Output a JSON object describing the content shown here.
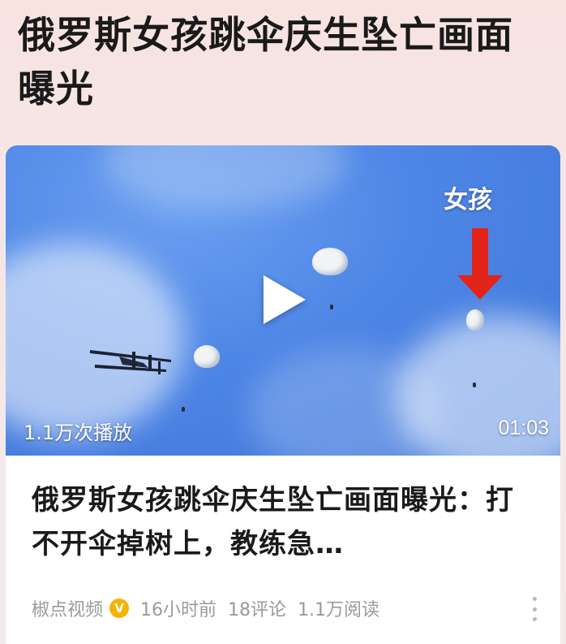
{
  "page": {
    "headline": "俄罗斯女孩跳伞庆生坠亡画面曝光"
  },
  "video": {
    "views": "1.1万次播放",
    "duration": "01:03",
    "overlay_label": "女孩",
    "accent_color": "#e2231a",
    "play_icon": "play-icon"
  },
  "article": {
    "title": "俄罗斯女孩跳伞庆生坠亡画面曝光：打不开伞掉树上，教练急…",
    "source": "椒点视频",
    "verified_icon": "v-badge-icon",
    "verified_color": "#f5b300",
    "time": "16小时前",
    "comments": "18评论",
    "reads": "1.1万阅读",
    "more_icon": "more-vertical-icon"
  }
}
